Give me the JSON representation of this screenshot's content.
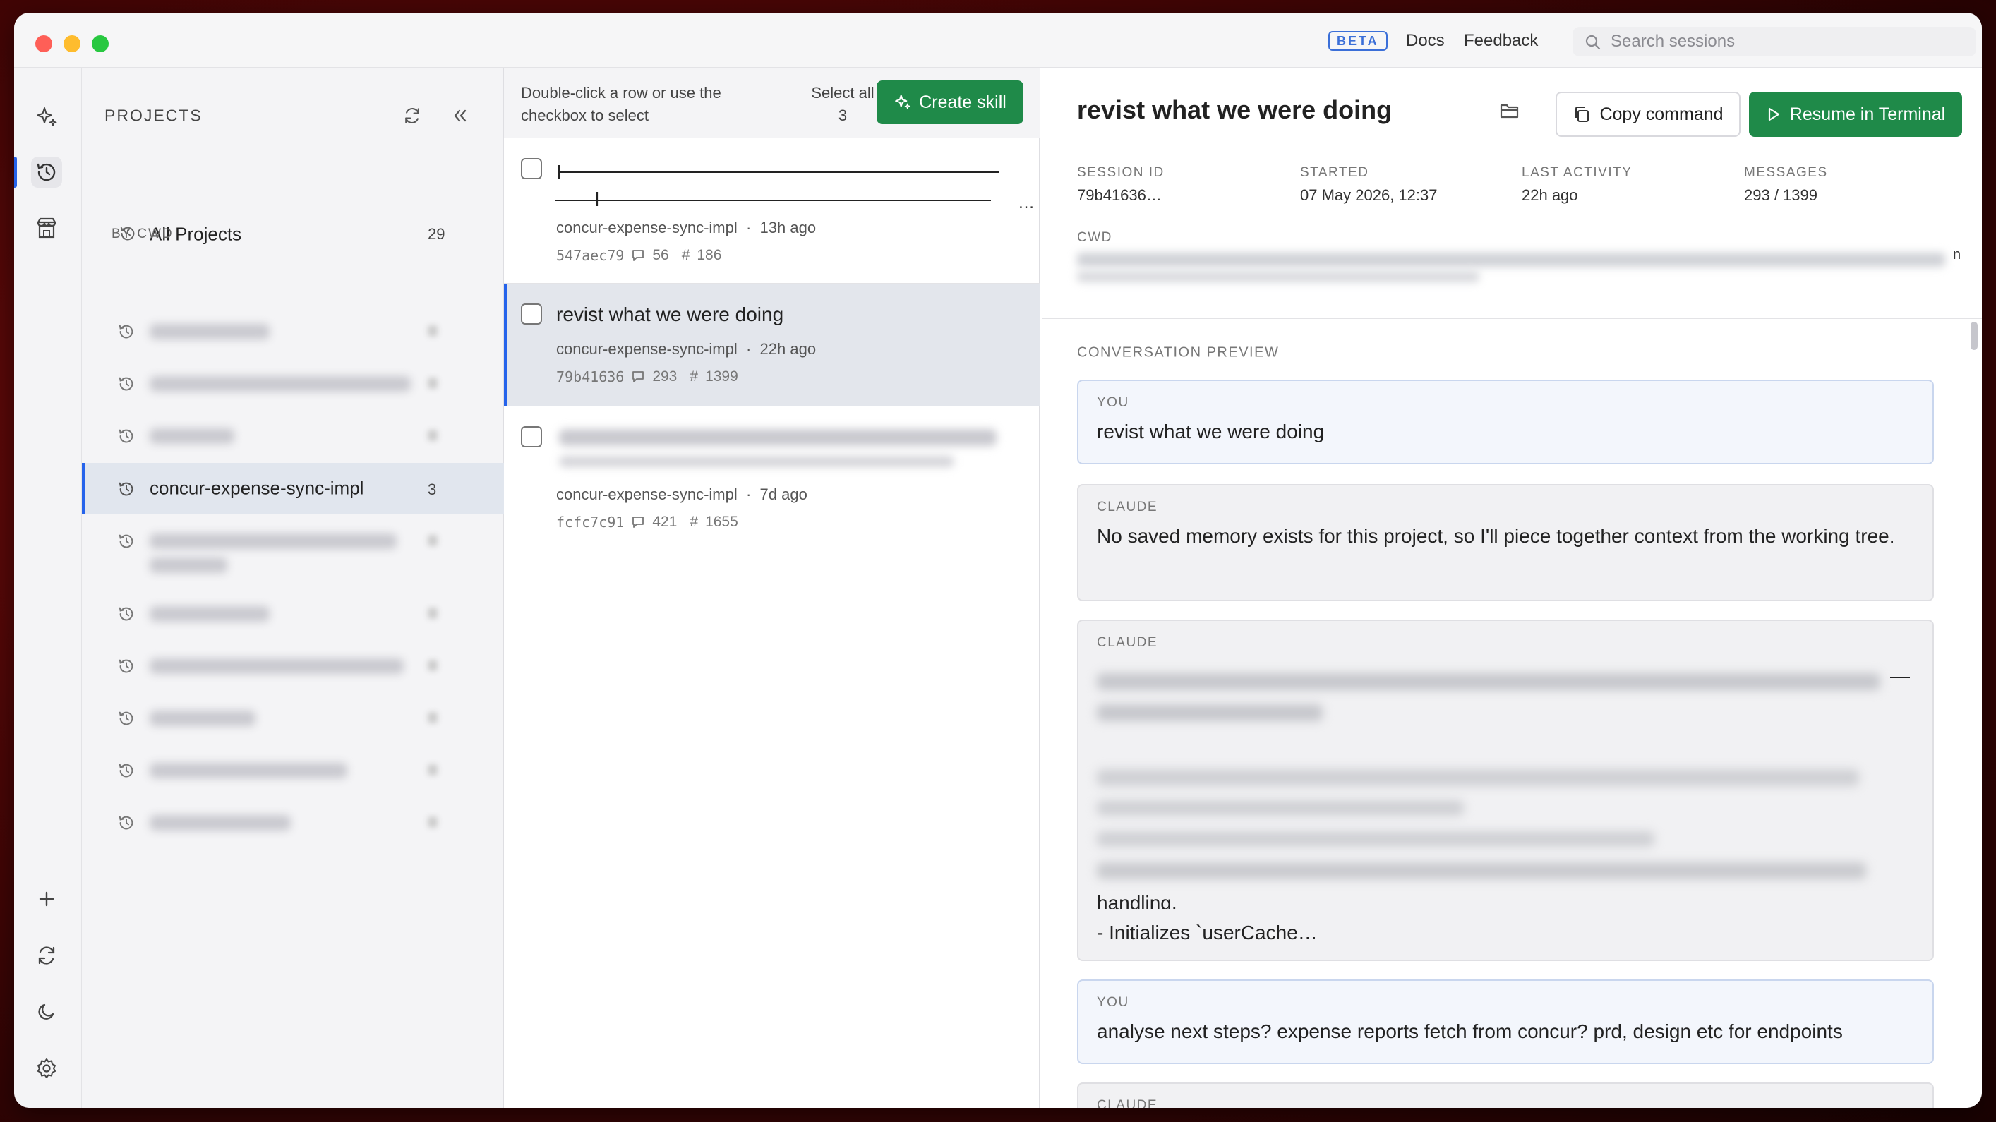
{
  "titlebar": {
    "beta": "BETA",
    "docs": "Docs",
    "feedback": "Feedback",
    "search_placeholder": "Search sessions"
  },
  "projects": {
    "heading": "PROJECTS",
    "all_projects": {
      "label": "All Projects",
      "count": "29"
    },
    "by_cwd": "BY CWD",
    "selected": {
      "label": "concur-expense-sync-impl",
      "count": "3"
    }
  },
  "sessions": {
    "hint": "Double-click a row or use the checkbox to select",
    "select_all": "Select all 3",
    "create_skill": "Create skill",
    "rows": [
      {
        "title": "",
        "project": "concur-expense-sync-impl",
        "age": "13h ago",
        "id": "547aec79",
        "messages": "56",
        "count": "186"
      },
      {
        "title": "revist what we were doing",
        "project": "concur-expense-sync-impl",
        "age": "22h ago",
        "id": "79b41636",
        "messages": "293",
        "count": "1399"
      },
      {
        "title": "",
        "project": "concur-expense-sync-impl",
        "age": "7d ago",
        "id": "fcfc7c91",
        "messages": "421",
        "count": "1655"
      }
    ]
  },
  "detail": {
    "title": "revist what we were doing",
    "copy_command": "Copy command",
    "resume": "Resume in Terminal",
    "meta": {
      "session_id_label": "SESSION ID",
      "session_id": "79b41636…",
      "started_label": "STARTED",
      "started": "07 May 2026, 12:37",
      "last_activity_label": "LAST ACTIVITY",
      "last_activity": "22h ago",
      "messages_label": "MESSAGES",
      "messages": "293 / 1399"
    },
    "cwd_label": "CWD",
    "cwd_tail": "n",
    "conversation_label": "CONVERSATION PREVIEW",
    "messages": [
      {
        "role": "YOU",
        "text": "revist what we were doing"
      },
      {
        "role": "CLAUDE",
        "text": "No saved memory exists for this project, so I'll piece together context from the working tree."
      },
      {
        "role": "CLAUDE",
        "text_tail_1": "handling.",
        "text_tail_2": "- Initializes `userCache…",
        "dash": "—"
      },
      {
        "role": "YOU",
        "text": "analyse next steps? expense reports fetch from concur? prd, design etc for endpoints"
      },
      {
        "role": "CLAUDE"
      }
    ]
  },
  "colors": {
    "accent_blue": "#2563eb",
    "primary_green": "#1f8a49"
  }
}
